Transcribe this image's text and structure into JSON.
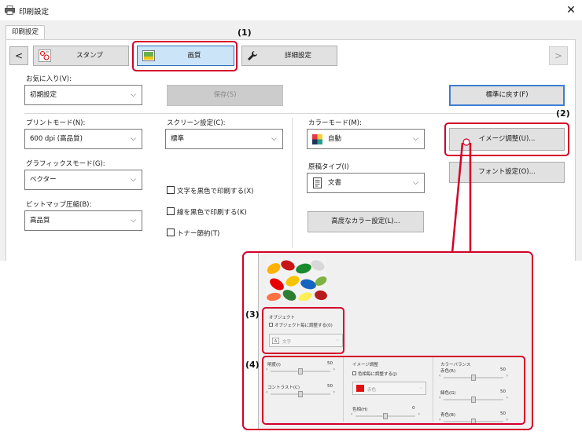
{
  "window": {
    "title": "印刷設定",
    "close_glyph": "✕",
    "tab": "印刷設定"
  },
  "tabs": {
    "prev_glyph": "<",
    "next_glyph": ">",
    "stamp": "スタンプ",
    "image_quality": "画質",
    "advanced": "詳細設定"
  },
  "favorites": {
    "label": "お気に入り(V):",
    "value": "初期設定",
    "save_button": "保存(S)",
    "reset_button": "標準に戻す(F)"
  },
  "print_mode": {
    "label": "プリントモード(N):",
    "value": "600 dpi (高品質)"
  },
  "graphics_mode": {
    "label": "グラフィックスモード(G):",
    "value": "ベクター"
  },
  "bitmap_compression": {
    "label": "ビットマップ圧縮(B):",
    "value": "高品質"
  },
  "screen_settings": {
    "label": "スクリーン設定(C):",
    "value": "標準"
  },
  "checkboxes": {
    "text_black": "文字を黒色で印刷する(X)",
    "line_black": "線を黒色で印刷する(K)",
    "toner_save": "トナー節約(T)"
  },
  "color_mode": {
    "label": "カラーモード(M):",
    "value": "自動"
  },
  "original_type": {
    "label": "原稿タイプ(I)",
    "value": "文書"
  },
  "advanced_color_button": "高度なカラー設定(L)...",
  "image_adjust_button": "イメージ調整(U)...",
  "font_settings_button": "フォント設定(O)...",
  "callouts": {
    "c1": "(1)",
    "c2": "(2)",
    "c3": "(3)",
    "c4": "(4)"
  },
  "popup": {
    "object_title": "オブジェクト",
    "object_checkbox": "オブジェクト毎に調整する(0)",
    "object_value": "文字",
    "brightness_label": "明度(I)",
    "brightness_value": "50",
    "contrast_label": "コントラスト(C)",
    "contrast_value": "50",
    "image_adjust_title": "イメージ調整",
    "hue_checkbox": "色相毎に調整する(J)",
    "hue_color_value": "赤色",
    "saturation_label": "色相(H)",
    "saturation_value": "0",
    "color_balance_title": "カラーバランス",
    "red_label": "赤色(R)",
    "red_value": "50",
    "green_label": "緑色(G)",
    "green_value": "50",
    "blue_label": "青色(B)",
    "blue_value": "50"
  },
  "colors": {
    "callout_red": "#d4002a",
    "active_tab": "#cce4f7"
  }
}
